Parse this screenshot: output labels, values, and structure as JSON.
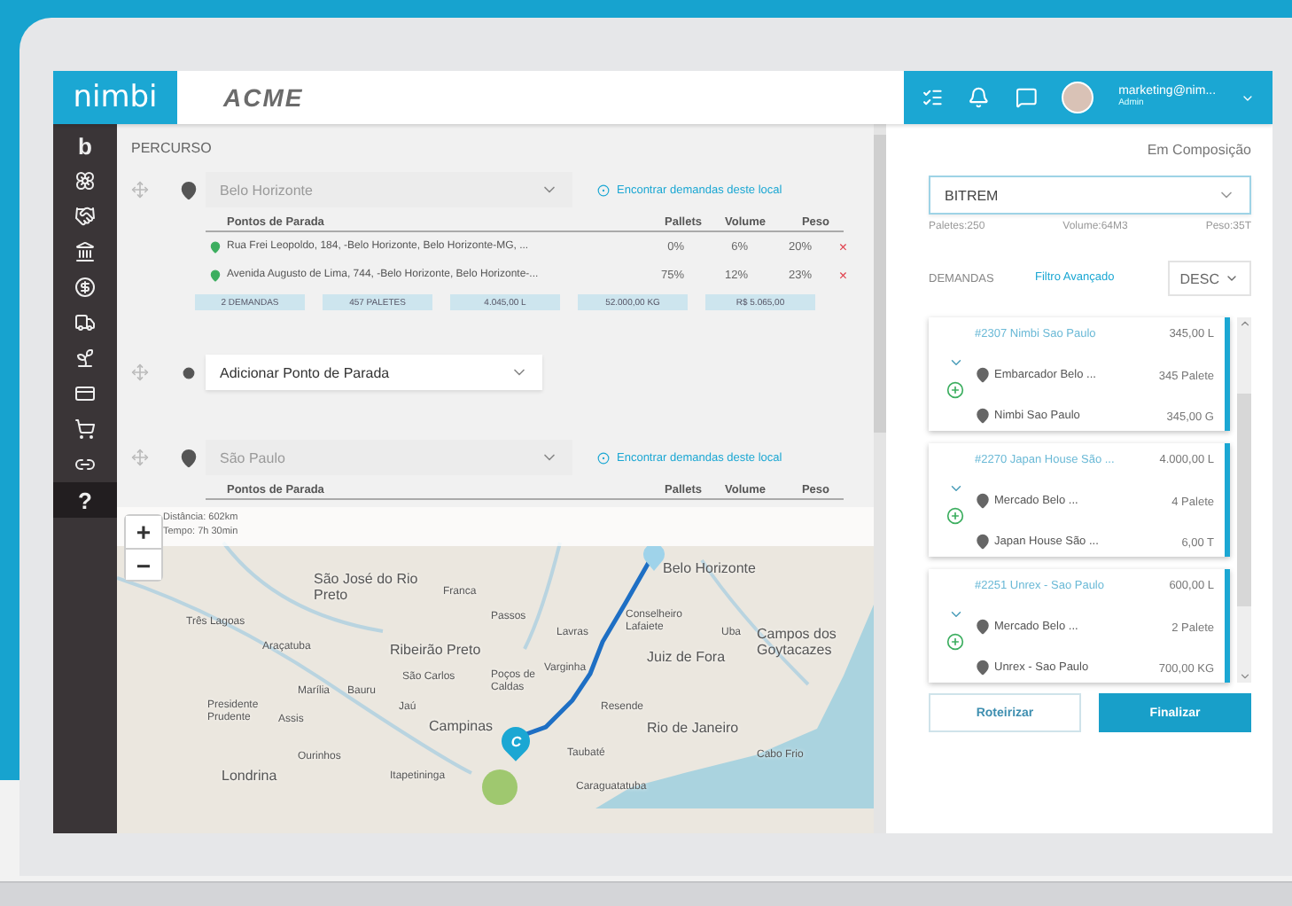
{
  "header": {
    "logo": "nimbi",
    "company": "ACME",
    "user": {
      "email": "marketing@nim...",
      "role": "Admin"
    }
  },
  "sidebar": {
    "items": [
      {
        "glyph": "b",
        "selected": false
      },
      {
        "selected": false
      },
      {
        "selected": false
      },
      {
        "selected": false
      },
      {
        "selected": false
      },
      {
        "selected": false
      },
      {
        "selected": false
      },
      {
        "selected": false
      },
      {
        "selected": false
      },
      {
        "selected": false
      },
      {
        "glyph": "?",
        "selected": true
      }
    ]
  },
  "route": {
    "title": "PERCURSO",
    "stops": [
      {
        "kind": "city",
        "placeholder": "Belo Horizonte",
        "find_link": "Encontrar demandas deste local",
        "table": {
          "columns": [
            "Pontos de Parada",
            "Pallets",
            "Volume",
            "Peso"
          ],
          "rows": [
            {
              "address": "Rua Frei Leopoldo, 184, -Belo Horizonte, Belo Horizonte-MG, ...",
              "pallets": "0%",
              "volume": "6%",
              "peso": "20%",
              "remove": "×"
            },
            {
              "address": "Avenida Augusto de Lima, 744, -Belo Horizonte, Belo Horizonte-...",
              "pallets": "75%",
              "volume": "12%",
              "peso": "23%",
              "remove": "×"
            }
          ]
        },
        "totals": [
          "2 DEMANDAS",
          "457 PALETES",
          "4.045,00 L",
          "52.000,00 KG",
          "R$ 5.065,00"
        ]
      },
      {
        "kind": "add",
        "label": "Adicionar Ponto de Parada"
      },
      {
        "kind": "city",
        "placeholder": "São Paulo",
        "find_link": "Encontrar demandas deste local",
        "table": {
          "columns": [
            "Pontos de Parada",
            "Pallets",
            "Volume",
            "Peso"
          ]
        }
      }
    ]
  },
  "map": {
    "info": [
      "Distância: 602km",
      "Tempo: 7h 30min"
    ],
    "zoom_in": "+",
    "zoom_out": "−",
    "markers": [
      "C"
    ],
    "places": [
      "Belo Horizonte",
      "São José do Rio Preto",
      "Franca",
      "Três Lagoas",
      "Passos",
      "Lavras",
      "Conselheiro Lafaiete",
      "Uba",
      "Araçatuba",
      "Ribeirão Preto",
      "Varginha",
      "Juiz de Fora",
      "Campos dos Goytacazes",
      "São Carlos",
      "Marília",
      "Bauru",
      "Poços de Caldas",
      "Presidente Prudente",
      "Jaú",
      "Resende",
      "Assis",
      "Campinas",
      "Rio de Janeiro",
      "Ourinhos",
      "Taubaté",
      "Cabo Frio",
      "Londrina",
      "Itapetininga",
      "Caraguatatuba"
    ]
  },
  "panel": {
    "status": "Em Composição",
    "vehicle": "BITREM",
    "stats": [
      "Paletes:250",
      "Volume:64M3",
      "Peso:35T"
    ],
    "demands": {
      "title": "DEMANDAS",
      "filter_link": "Filtro Avançado",
      "sort": "DESC",
      "cards": [
        {
          "title": "#2307 Nimbi Sao Paulo",
          "origin": "Embarcador Belo ...",
          "destination": "Nimbi Sao Paulo",
          "amounts": [
            "345,00 L",
            "345 Palete",
            "345,00 G"
          ]
        },
        {
          "title": "#2270 Japan House São ...",
          "origin": "Mercado Belo ...",
          "destination": "Japan House São ...",
          "amounts": [
            "4.000,00 L",
            "4 Palete",
            "6,00 T"
          ]
        },
        {
          "title": "#2251 Unrex - Sao Paulo",
          "origin": "Mercado Belo ...",
          "destination": "Unrex - Sao Paulo",
          "amounts": [
            "600,00 L",
            "2 Palete",
            "700,00 KG"
          ]
        }
      ]
    },
    "buttons": [
      {
        "label": "Roteirizar",
        "kind": "secondary"
      },
      {
        "label": "Finalizar",
        "kind": "primary"
      }
    ]
  }
}
